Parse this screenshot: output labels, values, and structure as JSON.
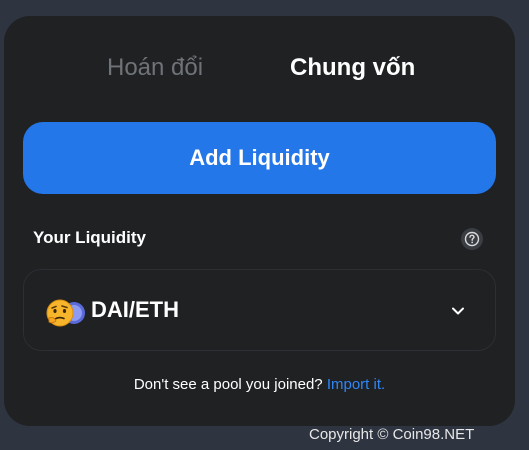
{
  "tabs": {
    "swap_label": "Hoán đổi",
    "pool_label": "Chung vốn"
  },
  "add_liquidity_label": "Add Liquidity",
  "your_liquidity_label": "Your Liquidity",
  "pool": {
    "pair": "DAI/ETH",
    "icons": [
      "dai-emoji-icon",
      "eth-icon"
    ]
  },
  "import_prompt": "Don't see a pool you joined?",
  "import_link": "Import it.",
  "copyright": "Copyright © Coin98.NET",
  "colors": {
    "accent": "#2477e8",
    "link": "#2f86f6",
    "card": "#1f2123",
    "background": "#2e3440"
  }
}
